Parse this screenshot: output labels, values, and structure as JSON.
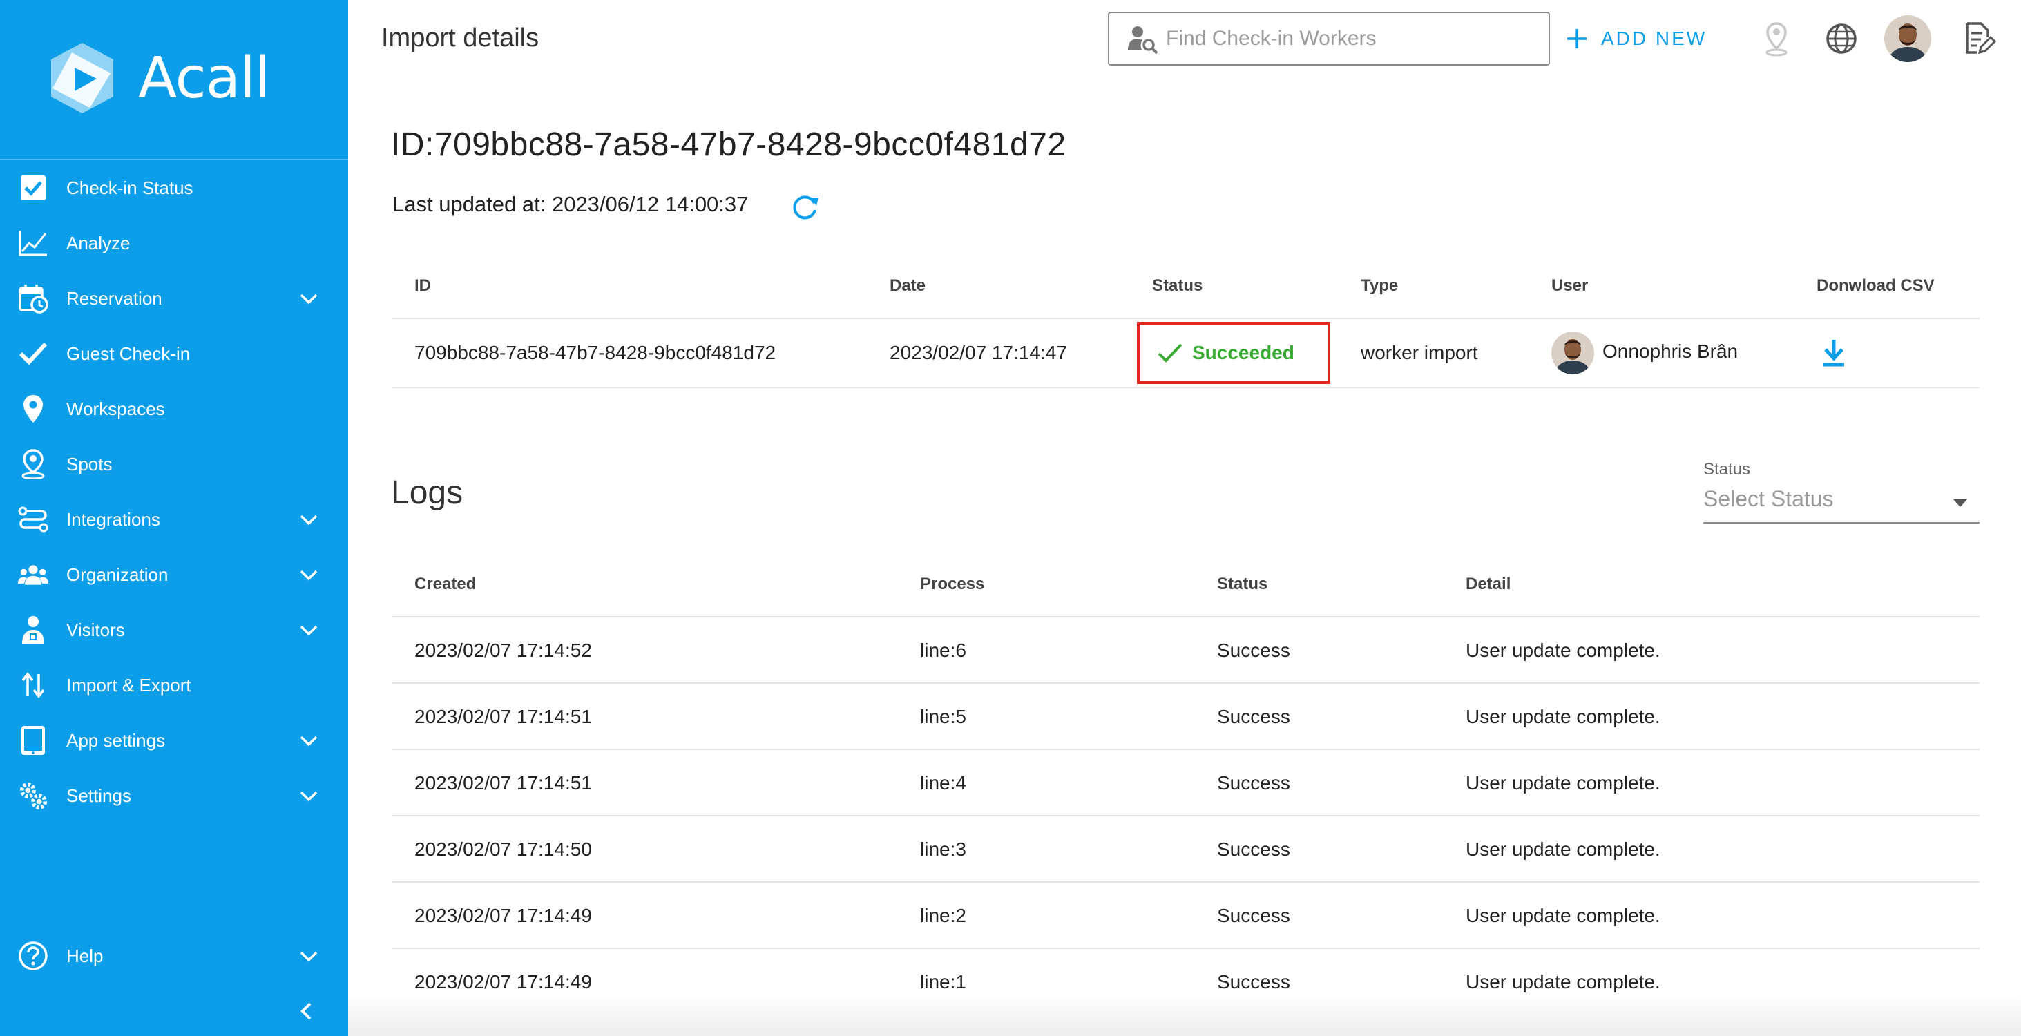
{
  "app": {
    "name": "Acall"
  },
  "sidebar": {
    "items": [
      {
        "label": "Check-in Status",
        "icon": "checkbox-icon"
      },
      {
        "label": "Analyze",
        "icon": "chart-line-icon"
      },
      {
        "label": "Reservation",
        "icon": "calendar-clock-icon",
        "expandable": true
      },
      {
        "label": "Guest Check-in",
        "icon": "check-icon"
      },
      {
        "label": "Workspaces",
        "icon": "map-pin-icon"
      },
      {
        "label": "Spots",
        "icon": "person-pin-icon"
      },
      {
        "label": "Integrations",
        "icon": "integrations-icon",
        "expandable": true
      },
      {
        "label": "Organization",
        "icon": "people-icon",
        "expandable": true
      },
      {
        "label": "Visitors",
        "icon": "visitor-icon",
        "expandable": true
      },
      {
        "label": "Import & Export",
        "icon": "import-export-icon"
      },
      {
        "label": "App settings",
        "icon": "tablet-icon",
        "expandable": true
      },
      {
        "label": "Settings",
        "icon": "gears-icon",
        "expandable": true
      }
    ],
    "help": {
      "label": "Help",
      "icon": "help-icon"
    }
  },
  "header": {
    "title": "Import details",
    "search_placeholder": "Find Check-in Workers",
    "add_new_label": "ADD NEW"
  },
  "import": {
    "id_text": "ID:709bbc88-7a58-47b7-8428-9bcc0f481d72",
    "last_updated": "Last updated at: 2023/06/12 14:00:37",
    "columns": [
      "ID",
      "Date",
      "Status",
      "Type",
      "User",
      "Donwload CSV"
    ],
    "row": {
      "id": "709bbc88-7a58-47b7-8428-9bcc0f481d72",
      "date": "2023/02/07 17:14:47",
      "status": "Succeeded",
      "type": "worker import",
      "user": "Onnophris Brân"
    }
  },
  "logs": {
    "title": "Logs",
    "filter_label": "Status",
    "filter_placeholder": "Select Status",
    "columns": [
      "Created",
      "Process",
      "Status",
      "Detail"
    ],
    "rows": [
      {
        "created": "2023/02/07 17:14:52",
        "process": "line:6",
        "status": "Success",
        "detail": "User update complete."
      },
      {
        "created": "2023/02/07 17:14:51",
        "process": "line:5",
        "status": "Success",
        "detail": "User update complete."
      },
      {
        "created": "2023/02/07 17:14:51",
        "process": "line:4",
        "status": "Success",
        "detail": "User update complete."
      },
      {
        "created": "2023/02/07 17:14:50",
        "process": "line:3",
        "status": "Success",
        "detail": "User update complete."
      },
      {
        "created": "2023/02/07 17:14:49",
        "process": "line:2",
        "status": "Success",
        "detail": "User update complete."
      },
      {
        "created": "2023/02/07 17:14:49",
        "process": "line:1",
        "status": "Success",
        "detail": "User update complete."
      }
    ]
  },
  "colors": {
    "brand": "#0c9ee8",
    "success": "#3aaa35",
    "highlight": "#e0281e"
  }
}
